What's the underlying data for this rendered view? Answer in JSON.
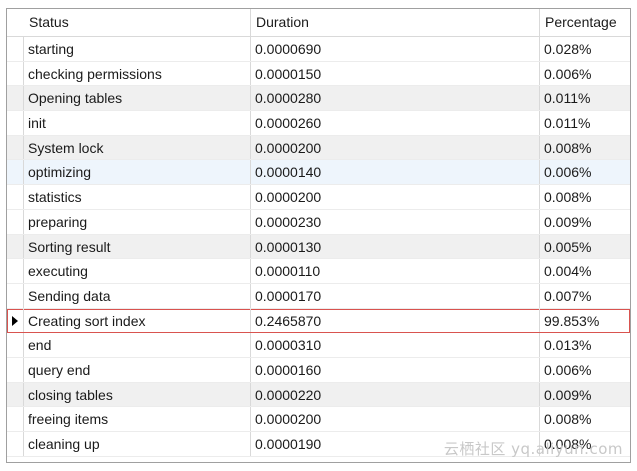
{
  "columns": [
    "Status",
    "Duration",
    "Percentage"
  ],
  "rows": [
    {
      "status": "starting",
      "duration": "0.0000690",
      "percentage": "0.028%"
    },
    {
      "status": "checking permissions",
      "duration": "0.0000150",
      "percentage": "0.006%"
    },
    {
      "status": "Opening tables",
      "duration": "0.0000280",
      "percentage": "0.011%"
    },
    {
      "status": "init",
      "duration": "0.0000260",
      "percentage": "0.011%"
    },
    {
      "status": "System lock",
      "duration": "0.0000200",
      "percentage": "0.008%"
    },
    {
      "status": "optimizing",
      "duration": "0.0000140",
      "percentage": "0.006%"
    },
    {
      "status": "statistics",
      "duration": "0.0000200",
      "percentage": "0.008%"
    },
    {
      "status": "preparing",
      "duration": "0.0000230",
      "percentage": "0.009%"
    },
    {
      "status": "Sorting result",
      "duration": "0.0000130",
      "percentage": "0.005%"
    },
    {
      "status": "executing",
      "duration": "0.0000110",
      "percentage": "0.004%"
    },
    {
      "status": "Sending data",
      "duration": "0.0000170",
      "percentage": "0.007%"
    },
    {
      "status": "Creating sort index",
      "duration": "0.2465870",
      "percentage": "99.853%"
    },
    {
      "status": "end",
      "duration": "0.0000310",
      "percentage": "0.013%"
    },
    {
      "status": "query end",
      "duration": "0.0000160",
      "percentage": "0.006%"
    },
    {
      "status": "closing tables",
      "duration": "0.0000220",
      "percentage": "0.009%"
    },
    {
      "status": "freeing items",
      "duration": "0.0000200",
      "percentage": "0.008%"
    },
    {
      "status": "cleaning up",
      "duration": "0.0000190",
      "percentage": "0.008%"
    }
  ],
  "selected_row": "Creating sort index",
  "colors": {
    "selection_border": "#d9534f",
    "row_alt": "#f0f0f0",
    "row_highlight": "#eef5fc"
  },
  "watermark": "云栖社区 yq.aliyun.com"
}
